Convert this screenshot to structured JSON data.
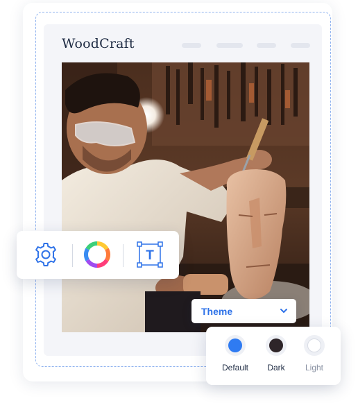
{
  "brand": {
    "name": "WoodCraft"
  },
  "toolbar": {
    "tools": [
      {
        "name": "settings",
        "icon": "gear-icon"
      },
      {
        "name": "color",
        "icon": "color-wheel-icon"
      },
      {
        "name": "text",
        "icon": "text-box-icon",
        "glyph": "T"
      }
    ]
  },
  "theme_select": {
    "label": "Theme",
    "icon": "chevron-down-icon"
  },
  "theme_options": [
    {
      "label": "Default",
      "color": "#2f7bf2",
      "label_color": "#1f2c44"
    },
    {
      "label": "Dark",
      "color": "#2e2529",
      "label_color": "#1f2c44"
    },
    {
      "label": "Light",
      "color": "#ffffff",
      "label_color": "#8a92a3"
    }
  ],
  "colors": {
    "accent": "#2e72e8",
    "frame_dash": "#8fb2ef"
  }
}
